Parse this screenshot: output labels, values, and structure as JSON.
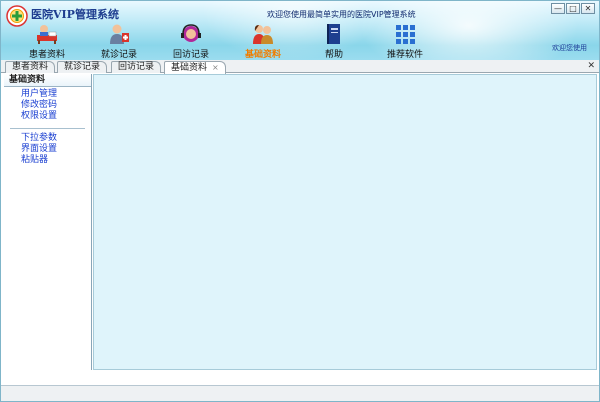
{
  "window": {
    "title": "医院VIP管理系统",
    "banner": "欢迎您使用最简单实用的医院VIP管理系统",
    "welcome": "欢迎您使用",
    "controls": {
      "minimize": "—",
      "maximize": "□",
      "close": "✕"
    }
  },
  "toolbar": {
    "items": [
      {
        "label": "患者资料",
        "icon": "patient-icon"
      },
      {
        "label": "就诊记录",
        "icon": "doctor-icon"
      },
      {
        "label": "回访记录",
        "icon": "headset-icon"
      },
      {
        "label": "基础资料",
        "icon": "users-icon",
        "active": true
      },
      {
        "label": "帮助",
        "icon": "book-icon"
      },
      {
        "label": "推荐软件",
        "icon": "grid-icon"
      }
    ]
  },
  "tabs": {
    "items": [
      {
        "label": "患者资料"
      },
      {
        "label": "就诊记录"
      },
      {
        "label": "回访记录"
      },
      {
        "label": "基础资料",
        "active": true
      }
    ],
    "close_tab": "×",
    "close_all": "✕"
  },
  "sidebar": {
    "title": "基础资料",
    "group1": [
      "用户管理",
      "修改密码",
      "权限设置"
    ],
    "group2": [
      "下拉参数",
      "界面设置",
      "粘贴器"
    ]
  },
  "colors": {
    "accent": "#f07d00",
    "link": "#1a3fd1",
    "content_bg": "#dff4fb"
  }
}
